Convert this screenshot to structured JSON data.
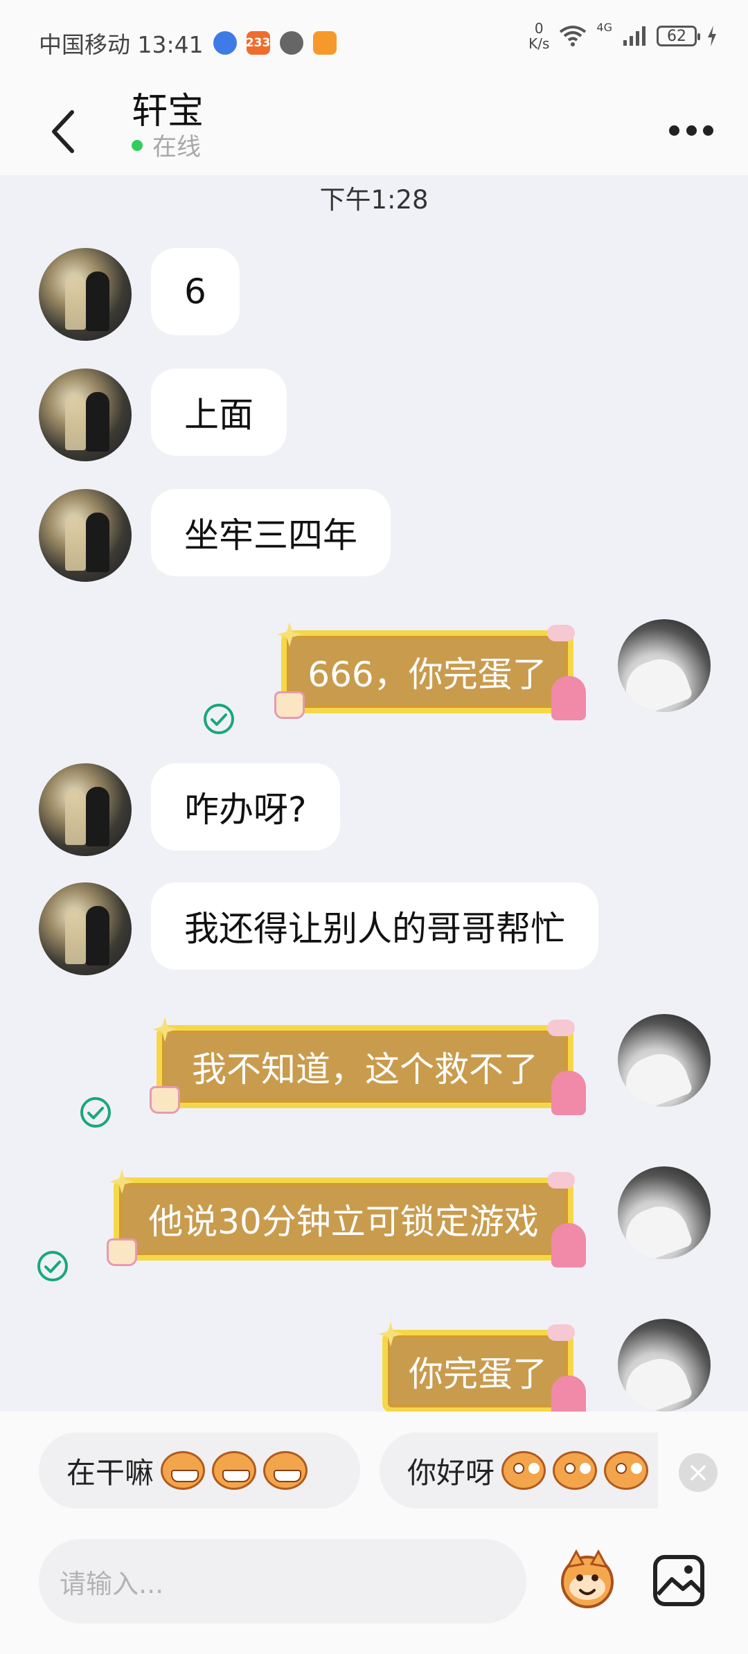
{
  "status_bar": {
    "carrier_time": "中国移动 13:41",
    "notif_badge": "233",
    "net_speed_value": "0",
    "net_speed_unit": "K/s",
    "network": "4G",
    "battery": "62"
  },
  "header": {
    "title": "轩宝",
    "status": "在线"
  },
  "timestamp": "下午1:28",
  "messages": [
    {
      "side": "in",
      "text": "6"
    },
    {
      "side": "in",
      "text": "上面"
    },
    {
      "side": "in",
      "text": "坐牢三四年"
    },
    {
      "side": "out",
      "text": "666，你完蛋了",
      "read": true
    },
    {
      "side": "in",
      "text": "咋办呀?"
    },
    {
      "side": "in",
      "text": "我还得让别人的哥哥帮忙"
    },
    {
      "side": "out",
      "text": "我不知道，这个救不了",
      "read": true
    },
    {
      "side": "out",
      "text": "他说30分钟立可锁定游戏",
      "read": true
    },
    {
      "side": "out",
      "text": "你完蛋了",
      "read": true
    }
  ],
  "quick_replies": [
    {
      "text": "在干嘛"
    },
    {
      "text": "你好呀"
    }
  ],
  "input": {
    "placeholder": "请输入..."
  },
  "colors": {
    "online": "#2fcf5a",
    "read_check": "#18a87a",
    "bubble_out_fill": "#c99b4d",
    "bubble_out_border": "#f5d84a"
  }
}
